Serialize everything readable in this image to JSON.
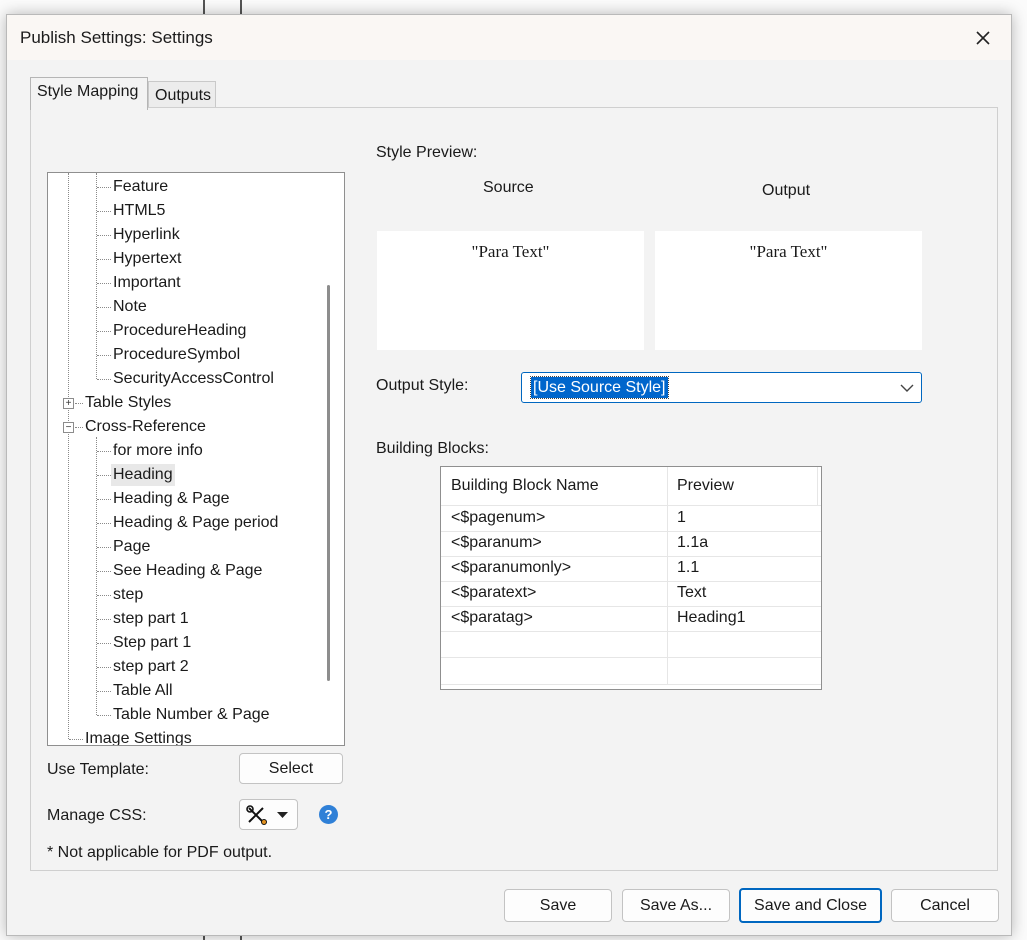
{
  "dialog": {
    "title": "Publish Settings: Settings",
    "close_label": "Close"
  },
  "tabs": [
    {
      "label": "Style Mapping",
      "active": true
    },
    {
      "label": "Outputs",
      "active": false
    }
  ],
  "tree": {
    "items": [
      {
        "label": "Feature",
        "level": 2
      },
      {
        "label": "HTML5",
        "level": 2
      },
      {
        "label": "Hyperlink",
        "level": 2
      },
      {
        "label": "Hypertext",
        "level": 2
      },
      {
        "label": "Important",
        "level": 2
      },
      {
        "label": "Note",
        "level": 2
      },
      {
        "label": "ProcedureHeading",
        "level": 2
      },
      {
        "label": "ProcedureSymbol",
        "level": 2
      },
      {
        "label": "SecurityAccessControl",
        "level": 2
      },
      {
        "label": "Table Styles",
        "level": 1,
        "expander": "+"
      },
      {
        "label": "Cross-Reference",
        "level": 1,
        "expander": "-"
      },
      {
        "label": "for more info",
        "level": 2
      },
      {
        "label": "Heading",
        "level": 2,
        "selected": true
      },
      {
        "label": "Heading & Page",
        "level": 2
      },
      {
        "label": "Heading & Page period",
        "level": 2
      },
      {
        "label": "Page",
        "level": 2
      },
      {
        "label": "See Heading & Page",
        "level": 2
      },
      {
        "label": "step",
        "level": 2
      },
      {
        "label": "step part 1",
        "level": 2
      },
      {
        "label": "Step part 1",
        "level": 2
      },
      {
        "label": "step part 2",
        "level": 2
      },
      {
        "label": "Table All",
        "level": 2
      },
      {
        "label": "Table Number & Page",
        "level": 2
      },
      {
        "label": "Image Settings",
        "level": 1
      }
    ]
  },
  "template": {
    "label": "Use Template:",
    "button": "Select"
  },
  "css": {
    "label": "Manage CSS:",
    "tool_icon": "tools-icon",
    "help": "?"
  },
  "footnote": "* Not applicable for PDF output.",
  "style_preview": {
    "label": "Style Preview:",
    "source_label": "Source",
    "output_label": "Output",
    "source_text": "\"Para Text\"",
    "output_text": "\"Para Text\""
  },
  "output_style": {
    "label": "Output Style:",
    "value": "[Use Source Style]"
  },
  "building_blocks": {
    "label": "Building Blocks:",
    "columns": [
      "Building Block Name",
      "Preview"
    ],
    "rows": [
      [
        "<$pagenum>",
        "1"
      ],
      [
        "<$paranum>",
        "1.1a"
      ],
      [
        "<$paranumonly>",
        "1.1"
      ],
      [
        "<$paratext>",
        "Text"
      ],
      [
        "<$paratag>",
        "Heading1"
      ]
    ]
  },
  "buttons": {
    "save": "Save",
    "save_as": "Save As...",
    "save_close": "Save and Close",
    "cancel": "Cancel"
  },
  "colors": {
    "accent": "#0067c0",
    "selection": "#0066cc",
    "help": "#2f80d7"
  }
}
